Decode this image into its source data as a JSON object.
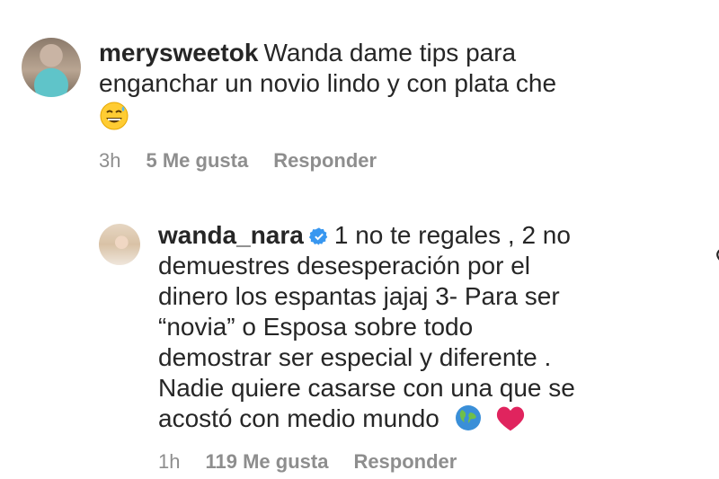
{
  "comments": [
    {
      "username": "merysweetok",
      "text": "Wanda dame tips para enganchar un novio lindo y con plata che",
      "emoji": "grinning-sweat-emoji",
      "time": "3h",
      "likes": "5 Me gusta",
      "reply_label": "Responder"
    },
    {
      "username": "wanda_nara",
      "verified": true,
      "text": "1 no te regales , 2 no demuestres desesperación por el dinero los espantas jajaj 3- Para ser “novia” o Esposa sobre todo demostrar ser especial y diferente . Nadie quiere casarse con una que se acostó con medio mundo",
      "emojis": [
        "globe-emoji",
        "red-heart-emoji"
      ],
      "time": "1h",
      "likes": "119 Me gusta",
      "reply_label": "Responder"
    }
  ],
  "colors": {
    "text": "#262626",
    "meta": "#8e8e8e",
    "verified": "#3897f0",
    "heart_emoji": "#e0245e"
  }
}
